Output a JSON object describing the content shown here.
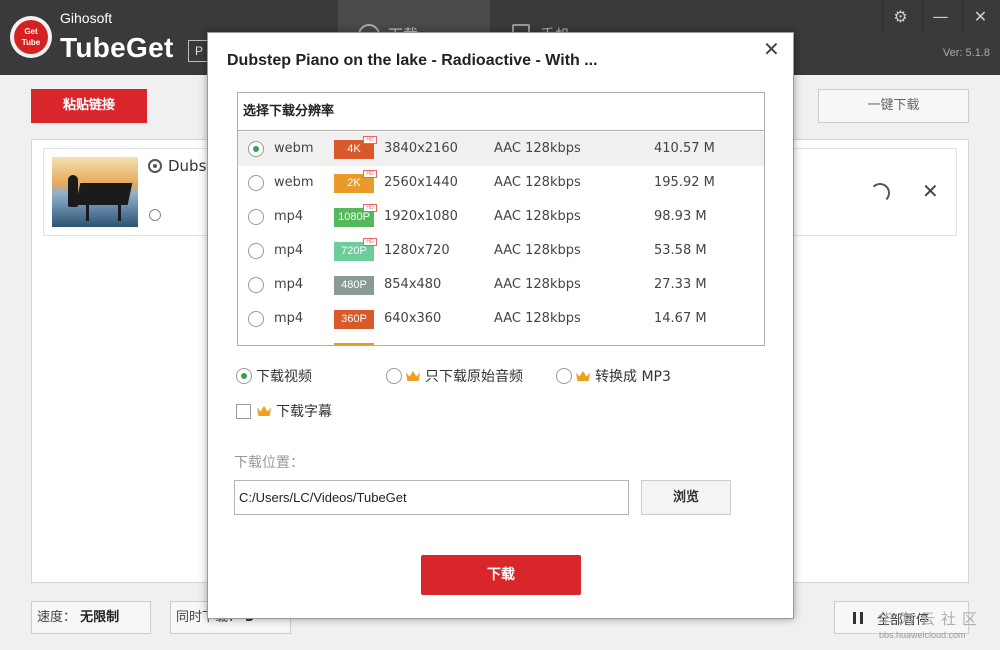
{
  "app": {
    "brand_sub": "Gihosoft",
    "brand_main": "TubeGet",
    "logo_text_top": "Get",
    "logo_text_bottom": "Tube",
    "pro_badge": "P",
    "tabs": [
      {
        "label": "下载",
        "icon": "download-icon"
      },
      {
        "label": "手机",
        "icon": "phone-icon"
      }
    ],
    "window_controls": {
      "settings": "⚙",
      "minimize": "—",
      "close": "✕"
    },
    "version": "Ver: 5.1.8"
  },
  "toolbar": {
    "paste_label": "粘贴链接",
    "onekey_label": "一键下载"
  },
  "download_list": [
    {
      "title": "Dubstep Piano on the lake - Radioactive - With ...",
      "title_visible": "Dubst",
      "status": "loading"
    }
  ],
  "status_bar": {
    "speed_label": "速度：",
    "speed_value": "无限制",
    "concurrent_label": "同时下载：",
    "concurrent_value": "3",
    "pause_all_label": "全部暂停"
  },
  "watermark": {
    "text": "华为云社区",
    "url": "bbs.huaweicloud.com"
  },
  "dialog": {
    "title": "Dubstep Piano on the lake - Radioactive - With ...",
    "close": "✕",
    "resolution_header": "选择下载分辨率",
    "resolutions": [
      {
        "format": "webm",
        "quality": "4K",
        "badge_color": "#d85a2a",
        "hd": true,
        "dimensions": "3840x2160",
        "audio": "AAC 128kbps",
        "size": "410.57 M",
        "selected": true
      },
      {
        "format": "webm",
        "quality": "2K",
        "badge_color": "#e89a2a",
        "hd": true,
        "dimensions": "2560x1440",
        "audio": "AAC 128kbps",
        "size": "195.92 M",
        "selected": false
      },
      {
        "format": "mp4",
        "quality": "1080P",
        "badge_color": "#55b85a",
        "hd": true,
        "dimensions": "1920x1080",
        "audio": "AAC 128kbps",
        "size": "98.93 M",
        "selected": false
      },
      {
        "format": "mp4",
        "quality": "720P",
        "badge_color": "#6ecc9a",
        "hd": true,
        "dimensions": "1280x720",
        "audio": "AAC 128kbps",
        "size": "53.58 M",
        "selected": false
      },
      {
        "format": "mp4",
        "quality": "480P",
        "badge_color": "#8a9a94",
        "hd": false,
        "dimensions": "854x480",
        "audio": "AAC 128kbps",
        "size": "27.33 M",
        "selected": false
      },
      {
        "format": "mp4",
        "quality": "360P",
        "badge_color": "#d85a2a",
        "hd": false,
        "dimensions": "640x360",
        "audio": "AAC 128kbps",
        "size": "14.67 M",
        "selected": false
      }
    ],
    "hd_label": "HD",
    "options": {
      "video_label": "下载视频",
      "audio_label": "只下载原始音频",
      "mp3_label": "转换成 MP3",
      "subtitle_label": "下载字幕",
      "selected": "video"
    },
    "location_label": "下载位置：",
    "path_value": "C:/Users/LC/Videos/TubeGet",
    "browse_label": "浏览",
    "download_label": "下载"
  },
  "colors": {
    "accent_red": "#d9262b",
    "titlebar": "#3a3a3a",
    "radio_checked": "#2fa44f",
    "crown": "#f0a020"
  }
}
